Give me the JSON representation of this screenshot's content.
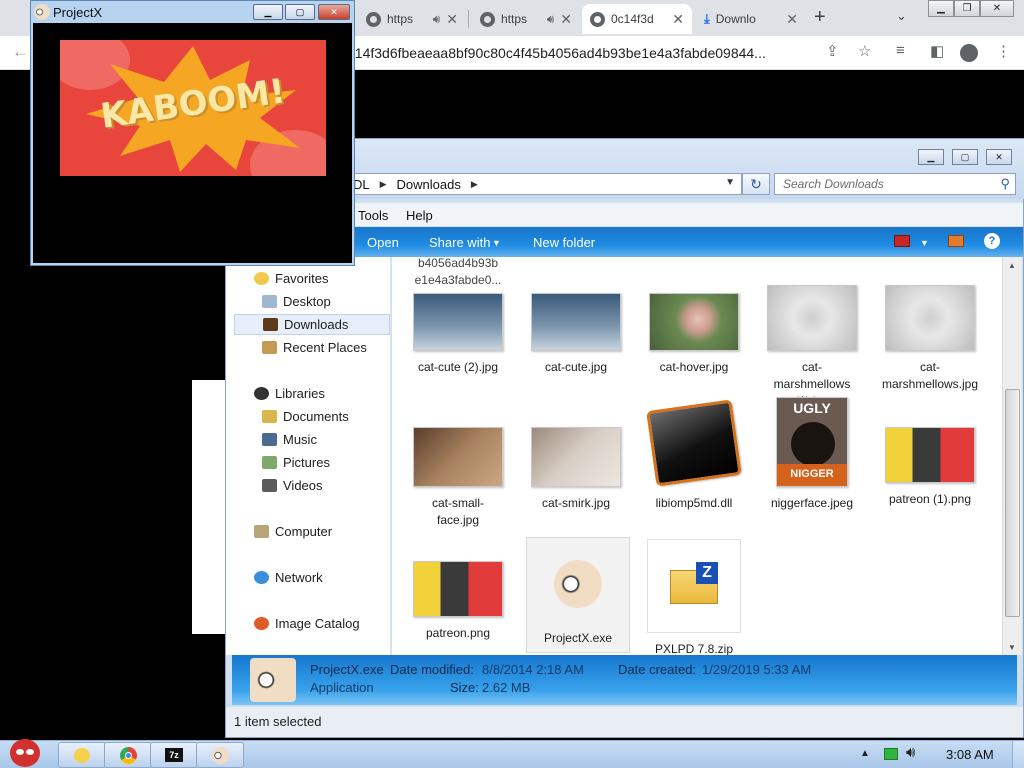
{
  "browser": {
    "tabs": [
      {
        "title": "https"
      },
      {
        "title": "https"
      },
      {
        "title": "0c14f3d"
      },
      {
        "title": "Downlo"
      }
    ],
    "address": "0c14f3d6fbeaeaa8bf90c80c4f45b4056ad4b93be1e4a3fabde09844..."
  },
  "projectx": {
    "title": "ProjectX",
    "banner_text": "KABOOM!"
  },
  "explorer": {
    "breadcrumb": {
      "part1": "DL",
      "part2": "Downloads"
    },
    "search_placeholder": "Search Downloads",
    "menu": {
      "tools": "Tools",
      "help": "Help"
    },
    "commands": {
      "open": "Open",
      "share": "Share with",
      "new_folder": "New folder"
    },
    "nav": {
      "favorites": "Favorites",
      "desktop": "Desktop",
      "downloads": "Downloads",
      "recent": "Recent Places",
      "libraries": "Libraries",
      "documents": "Documents",
      "music": "Music",
      "pictures": "Pictures",
      "videos": "Videos",
      "computer": "Computer",
      "network": "Network",
      "image_catalog": "Image Catalog"
    },
    "partial_file_line1": "b4056ad4b93b",
    "partial_file_line2": "e1e4a3fabde0...",
    "files": [
      {
        "name": "cat-cute (2).jpg"
      },
      {
        "name": "cat-cute.jpg"
      },
      {
        "name": "cat-hover.jpg"
      },
      {
        "name": "cat-marshmellows (1).jpg"
      },
      {
        "name": "cat-marshmellows.jpg"
      },
      {
        "name": "cat-small-face.jpg"
      },
      {
        "name": "cat-smirk.jpg"
      },
      {
        "name": "libiomp5md.dll"
      },
      {
        "name": "niggerface.jpeg",
        "caption_top": "UGLY",
        "caption_bottom": "NIGGER"
      },
      {
        "name": "patreon (1).png"
      },
      {
        "name": "patreon.png"
      },
      {
        "name": "ProjectX.exe"
      },
      {
        "name": "PXLPD 7.8.zip"
      }
    ],
    "details": {
      "name": "ProjectX.exe",
      "type": "Application",
      "modified_label": "Date modified:",
      "modified": "8/8/2014 2:18 AM",
      "size_label": "Size:",
      "size": "2.62 MB",
      "created_label": "Date created:",
      "created": "1/29/2019 5:33 AM"
    },
    "status": "1 item selected"
  },
  "taskbar": {
    "time": "3:08 AM"
  },
  "colors": {
    "accent_blue": "#1e8be2",
    "kaboom_red": "#e8453c",
    "kaboom_yellow": "#f5a623"
  }
}
